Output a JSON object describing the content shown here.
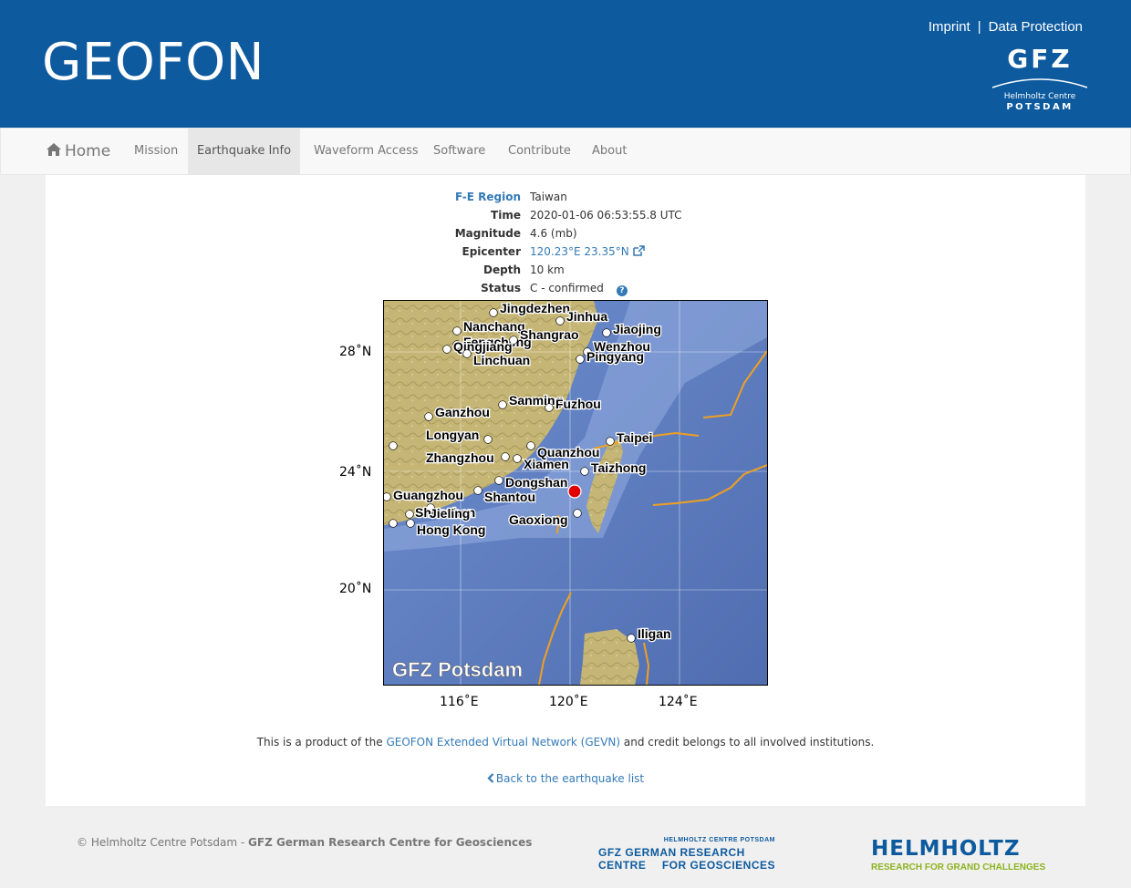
{
  "header": {
    "brand": "GEOFON",
    "links": [
      "Imprint",
      "Data Protection"
    ],
    "separator": "|",
    "logo": {
      "text": "GFZ",
      "sub1": "Helmholtz Centre",
      "sub2": "POTSDAM"
    }
  },
  "nav": {
    "home": "Home",
    "items": [
      "Mission",
      "Earthquake Info",
      "Waveform Access",
      "Software",
      "Contribute",
      "About"
    ],
    "active": "Earthquake Info"
  },
  "event": {
    "region_label": "F-E Region",
    "region": "Taiwan",
    "time_label": "Time",
    "time": "2020-01-06 06:53:55.8 UTC",
    "magnitude_label": "Magnitude",
    "magnitude": "4.6 (mb)",
    "epicenter_label": "Epicenter",
    "epicenter": "120.23°E 23.35°N",
    "depth_label": "Depth",
    "depth": "10 km",
    "status_label": "Status",
    "status": "C - confirmed"
  },
  "map": {
    "watermark": "GFZ Potsdam",
    "lat_ticks": [
      "28˚N",
      "24˚N",
      "20˚N"
    ],
    "lon_ticks": [
      "116˚E",
      "120˚E",
      "124˚E"
    ],
    "cities": [
      "Jingdezhen",
      "Jinhua",
      "Nanchang",
      "Jiaojing",
      "Fengcheng",
      "Shangrao",
      "Qingjiang",
      "Wenzhou",
      "Linchuan",
      "Pingyang",
      "Sanming",
      "Fuzhou",
      "Ganzhou",
      "Longyan",
      "Taipei",
      "Quanzhou",
      "Zhangzhou",
      "Xiamen",
      "Taizhong",
      "Dongshan",
      "Guangzhou",
      "Shantou",
      "Shenzhen",
      "Jieling",
      "Gaoxiong",
      "Hong Kong",
      "Iligan"
    ],
    "colors": {
      "land": "#c8b77a",
      "sea": "#5d7fc4",
      "plate": "#f0a020",
      "epicenter": "#e00000"
    }
  },
  "credit": {
    "before": "This is a product of the ",
    "link": "GEOFON Extended Virtual Network (GEVN)",
    "after": " and credit belongs to all involved institutions."
  },
  "back": "Back to the earthquake list",
  "footer": {
    "copyright_prefix": "© Helmholtz Centre Potsdam - ",
    "copyright_bold": "GFZ German Research Centre for Geosciences",
    "gfz_small": "HELMHOLTZ CENTRE POTSDAM",
    "gfz_line1": "GFZ GERMAN RESEARCH CENTRE",
    "gfz_line2": "FOR GEOSCIENCES",
    "helmholtz": "HELMHOLTZ",
    "helmholtz_tag": "RESEARCH FOR GRAND CHALLENGES"
  }
}
